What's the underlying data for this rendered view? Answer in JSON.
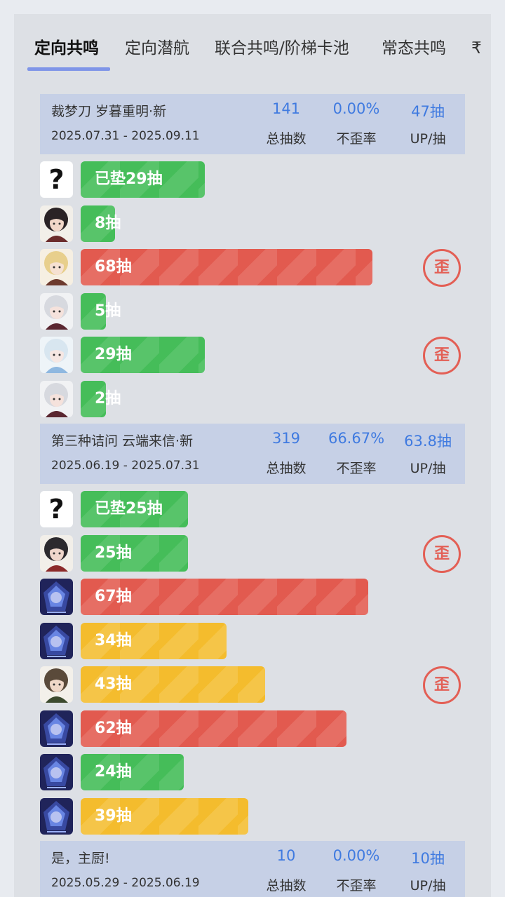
{
  "tabs": [
    {
      "label": "定向共鸣"
    },
    {
      "label": "定向潜航"
    },
    {
      "label": "联合共鸣/阶梯卡池"
    },
    {
      "label": "常态共鸣"
    },
    {
      "label": "₹"
    }
  ],
  "stat_labels": {
    "total": "总抽数",
    "rate": "不歪率",
    "per_up": "UP/抽"
  },
  "off_badge": "歪",
  "unknown_avatar": "?",
  "pools": [
    {
      "title": "裁梦刀 岁暮重明·新",
      "dates": "2025.07.31 - 2025.09.11",
      "total": "141",
      "rate": "0.00%",
      "per_up": "47抽",
      "rows": [
        {
          "label": "已垫29抽",
          "value": 29,
          "color": "green",
          "avatar": "unknown",
          "off": false
        },
        {
          "label": "8抽",
          "value": 8,
          "color": "green",
          "avatar": "char-dark-hair",
          "off": false
        },
        {
          "label": "68抽",
          "value": 68,
          "color": "red",
          "avatar": "char-blonde",
          "off": true
        },
        {
          "label": "5抽",
          "value": 5,
          "color": "green",
          "avatar": "char-silver-hair",
          "off": false
        },
        {
          "label": "29抽",
          "value": 29,
          "color": "green",
          "avatar": "char-blue-horns",
          "off": true
        },
        {
          "label": "2抽",
          "value": 2,
          "color": "green",
          "avatar": "char-silver-hair",
          "off": false
        }
      ]
    },
    {
      "title": "第三种诘问 云端来信·新",
      "dates": "2025.06.19 - 2025.07.31",
      "total": "319",
      "rate": "66.67%",
      "per_up": "63.8抽",
      "rows": [
        {
          "label": "已垫25抽",
          "value": 25,
          "color": "green",
          "avatar": "unknown",
          "off": false
        },
        {
          "label": "25抽",
          "value": 25,
          "color": "green",
          "avatar": "char-red-hat",
          "off": true
        },
        {
          "label": "67抽",
          "value": 67,
          "color": "red",
          "avatar": "char-blue-crystal",
          "off": false
        },
        {
          "label": "34抽",
          "value": 34,
          "color": "yellow",
          "avatar": "char-blue-crystal",
          "off": false
        },
        {
          "label": "43抽",
          "value": 43,
          "color": "yellow",
          "avatar": "char-officer",
          "off": true
        },
        {
          "label": "62抽",
          "value": 62,
          "color": "red",
          "avatar": "char-blue-crystal",
          "off": false
        },
        {
          "label": "24抽",
          "value": 24,
          "color": "green",
          "avatar": "char-blue-crystal",
          "off": false
        },
        {
          "label": "39抽",
          "value": 39,
          "color": "yellow",
          "avatar": "char-blue-crystal",
          "off": false
        }
      ]
    },
    {
      "title": "是，主厨!",
      "dates": "2025.05.29 - 2025.06.19",
      "total": "10",
      "rate": "0.00%",
      "per_up": "10抽",
      "rows": []
    }
  ],
  "colors": {
    "green": "#45bd59",
    "red": "#e25a4f",
    "yellow": "#f4bc2d",
    "accent": "#3f7ae0",
    "header_bg": "#c6d0e6"
  }
}
